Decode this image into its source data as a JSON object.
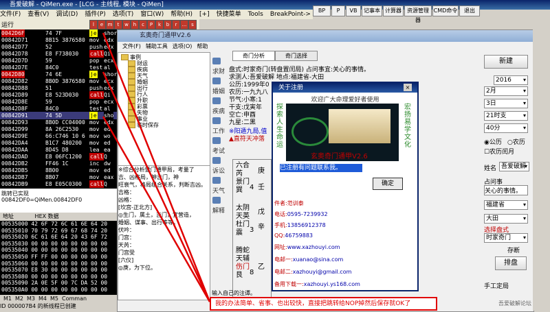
{
  "od": {
    "title": "吾爱破解 - QiMen.exe - [LCG - 主线程, 模块 - QiMen]",
    "menu": [
      "文件(F)",
      "查看(V)",
      "调试(D)",
      "插件(P)",
      "选项(T)",
      "窗口(W)",
      "帮助(H)",
      "[+]",
      "快捷菜单",
      "Tools",
      "BreakPoint->"
    ],
    "run_state": "运行",
    "toolbar_letters": [
      "l",
      "e",
      "m",
      "t",
      "w",
      "h",
      "c",
      "P",
      "k",
      "b",
      "r",
      "...",
      "s"
    ],
    "right_toolbar": [
      "BP",
      "P",
      "VB",
      "记事本",
      "计算器",
      "资源管理器",
      "CMD命令",
      "退出"
    ],
    "cpu_rows": [
      {
        "addr": "0042D6F",
        "hex": "74 7F",
        "mn": "je",
        "tail": "shor",
        "style": "yel",
        "sel": true
      },
      {
        "addr": "00842D71",
        "hex": "8B15 3876580",
        "mn": "mov",
        "tail": "edx",
        "style": "wht"
      },
      {
        "addr": "00842D77",
        "hex": "52",
        "mn": "push",
        "tail": "edx",
        "style": "wht"
      },
      {
        "addr": "00842D78",
        "hex": "E8 F738030",
        "mn": "call",
        "tail": "Qi",
        "style": "red"
      },
      {
        "addr": "00842D7D",
        "hex": "59",
        "mn": "pop",
        "tail": "ecx",
        "style": "wht"
      },
      {
        "addr": "00842D7E",
        "hex": "84C0",
        "mn": "test",
        "tail": "al",
        "style": "wht"
      },
      {
        "addr": "0042D80",
        "hex": "74 6E",
        "mn": "je",
        "tail": "shor",
        "style": "yel",
        "sel": true
      },
      {
        "addr": "00842D82",
        "hex": "8B0D 3876580",
        "mn": "mov",
        "tail": "ecx",
        "style": "wht"
      },
      {
        "addr": "00842D88",
        "hex": "51",
        "mn": "push",
        "tail": "ecx",
        "style": "wht"
      },
      {
        "addr": "00842D89",
        "hex": "E8 523D030",
        "mn": "call",
        "tail": "Qi",
        "style": "red"
      },
      {
        "addr": "00842D8E",
        "hex": "59",
        "mn": "pop",
        "tail": "ecx",
        "style": "wht"
      },
      {
        "addr": "00842D8F",
        "hex": "84C0",
        "mn": "test",
        "tail": "al",
        "style": "wht"
      },
      {
        "addr": "00842D91",
        "hex": "74 5D",
        "mn": "je",
        "tail": "sho",
        "style": "yel",
        "hl": true
      },
      {
        "addr": "00842D93",
        "hex": "8B0D CC04000",
        "mn": "mov",
        "tail": "edx",
        "style": "wht"
      },
      {
        "addr": "00842D99",
        "hex": "8A 26C2530",
        "mn": "mov",
        "tail": "ed",
        "style": "wht"
      },
      {
        "addr": "00842D9E",
        "hex": "66:C746 10 6",
        "mn": "mov",
        "tail": "wo",
        "style": "wht"
      },
      {
        "addr": "00842DA4",
        "hex": "B1C7 480200",
        "mn": "mov",
        "tail": "ed",
        "style": "wht"
      },
      {
        "addr": "00842DAA",
        "hex": "8D45 D8",
        "mn": "lea",
        "tail": "ea",
        "style": "wht"
      },
      {
        "addr": "00842DAD",
        "hex": "E8 06FC1200",
        "mn": "call",
        "tail": "Q",
        "style": "red"
      },
      {
        "addr": "00842DB2",
        "hex": "FF46 1C",
        "mn": "inc",
        "tail": "dw",
        "style": "wht"
      },
      {
        "addr": "00842DB5",
        "hex": "8B00",
        "mn": "mov",
        "tail": "ed",
        "style": "wht"
      },
      {
        "addr": "00842DB7",
        "hex": "8B07",
        "mn": "mov",
        "tail": "eax",
        "style": "wht"
      },
      {
        "addr": "00842DB9",
        "hex": "E8 E05C0300",
        "mn": "call",
        "tail": "Q",
        "style": "red"
      }
    ],
    "info_lines": [
      "跳转已实现",
      "00842DF0=QiMen.00842DF0"
    ],
    "dump_headers": [
      "地址",
      "HEX 数据"
    ],
    "dump_rows": [
      "00535000 42 6F 72 6C 61 6E 64 20",
      "00535010 70 79 72 69 67 68 74 20",
      "00535020 6C 61 6E 64 20 43 6F 72",
      "00535030 00 00 00 00 00 00 00 00",
      "00535040 00 00 00 00 00 00 00 00",
      "00535050 FF FF 00 00 00 00 00 00",
      "00535060 00 00 00 00 00 00 00 00",
      "00535070 E8 30 00 00 00 00 00 00",
      "00535080 00 00 00 00 00 00 00 00",
      "00535090 2A 0E 5F 00 7C DA 52 00",
      "005350A0 00 00 00 00 00 00 00 00"
    ],
    "mtabs": [
      "M1",
      "M2",
      "M3",
      "M4",
      "M5",
      "Comman"
    ],
    "status": "ID 000007B4 的新线程已创建"
  },
  "qm": {
    "title": "玄奥奇门通甲V2.6",
    "menu": [
      "文件(F)",
      "辅助工具",
      "选项(O)",
      "帮助(H)"
    ],
    "tree": [
      "事例",
      "财运",
      "疾病",
      "天气",
      "婚姻",
      "出行",
      "行人",
      "升职",
      "彩票",
      "失物",
      "事业",
      "临时保存"
    ],
    "analysis": [
      "※综合分析暨门通甲局，考量了",
      "吉、凶格局，神吉门，神",
      "旺衰气，格局组合关系，判断吉凶。",
      "吉格：",
      "凶格：",
      "[坎宫-正北方]",
      "◎生门，属土，吉门，宜营造，",
      "婚姻、谋事、出行等等。",
      "伏吟：",
      "门宫：",
      "天芮：",
      "门宫受",
      "[六仪]",
      "◎庚，为下位。"
    ],
    "left_icons": [
      "求财",
      "婚姻",
      "疾病",
      "工作",
      "考试",
      "诉讼",
      "天气",
      "解释"
    ],
    "tabs": [
      "奇门分析",
      "奇门选择"
    ],
    "lines": [
      "盘式:时家奇门(转盘置闰局)  占问事宜:关心的事情。",
      "求测人:吾爱破解  地点:福建省-大田",
      "公历:1999年0",
      "农历:一九九八",
      "节气:小寒:1",
      "干支:戊寅年",
      "空亡:申酉",
      "九星:二黑"
    ],
    "flags": [
      "※阳遁九局,值",
      "▲直符天冲落"
    ],
    "grid": [
      "六合",
      "芮",
      "景门",
      "巽",
      "太阴",
      "天英",
      "杜门",
      "震",
      "腾蛇",
      "天辅",
      "伤门",
      "艮"
    ],
    "grid_stems": [
      "庚",
      "壬",
      "戊",
      "辛",
      "乙"
    ],
    "grid_nums": [
      "4",
      "3",
      "8"
    ],
    "input_hint": "输入自己的注谭。"
  },
  "rp": {
    "new_btn": "新建",
    "year": "2016",
    "month": "2月",
    "day": "3日",
    "hour": "21时支",
    "minute": "40分",
    "radio_solar": "公历",
    "radio_lunar": "农历",
    "leap": "农历闰月",
    "name_label": "姓名",
    "name_value": "吾爱破解",
    "event_label": "占问事",
    "event_value": "关心的事情。",
    "province": "福建省",
    "city": "大田",
    "mode_label": "选择盘式",
    "mode_value": "时家奇门",
    "save_btn": "存断",
    "arrange_btn": "排盘",
    "hand_label": "手工定局"
  },
  "dlg": {
    "title": "关于注册",
    "close": "×",
    "welcome": "欢迎广大命理爱好者使用",
    "left_v": "探索人生命运",
    "right_v": "宏扬易学文化",
    "caption": "玄奥奇门通甲V2.6",
    "registered": "已注册有问题联系我。",
    "ok": "确定",
    "author_k": "件者:范训泰",
    "phone_k": "电话:",
    "phone_v": "0595-7239932",
    "mobile_k": "手机:",
    "mobile_v": "13856912378",
    "qq_k": "QQ:",
    "qq_v": "46759883",
    "site_k": "网址:",
    "site_v": "www.xazhouyi.com",
    "mail1_k": "电邮一:",
    "mail1_v": "xuanao@sina.com",
    "mail2_k": "电邮二:",
    "mail2_v": "xazhouyi@gmail.com",
    "dl_k": "备用下载一:",
    "dl_v": "xazhouyi.ys168.com"
  },
  "note": "我的办法简单、省事、也出较快，直接把跳转给NOP掉然后保存就OK了",
  "watermark": "吾爱破解论坛"
}
